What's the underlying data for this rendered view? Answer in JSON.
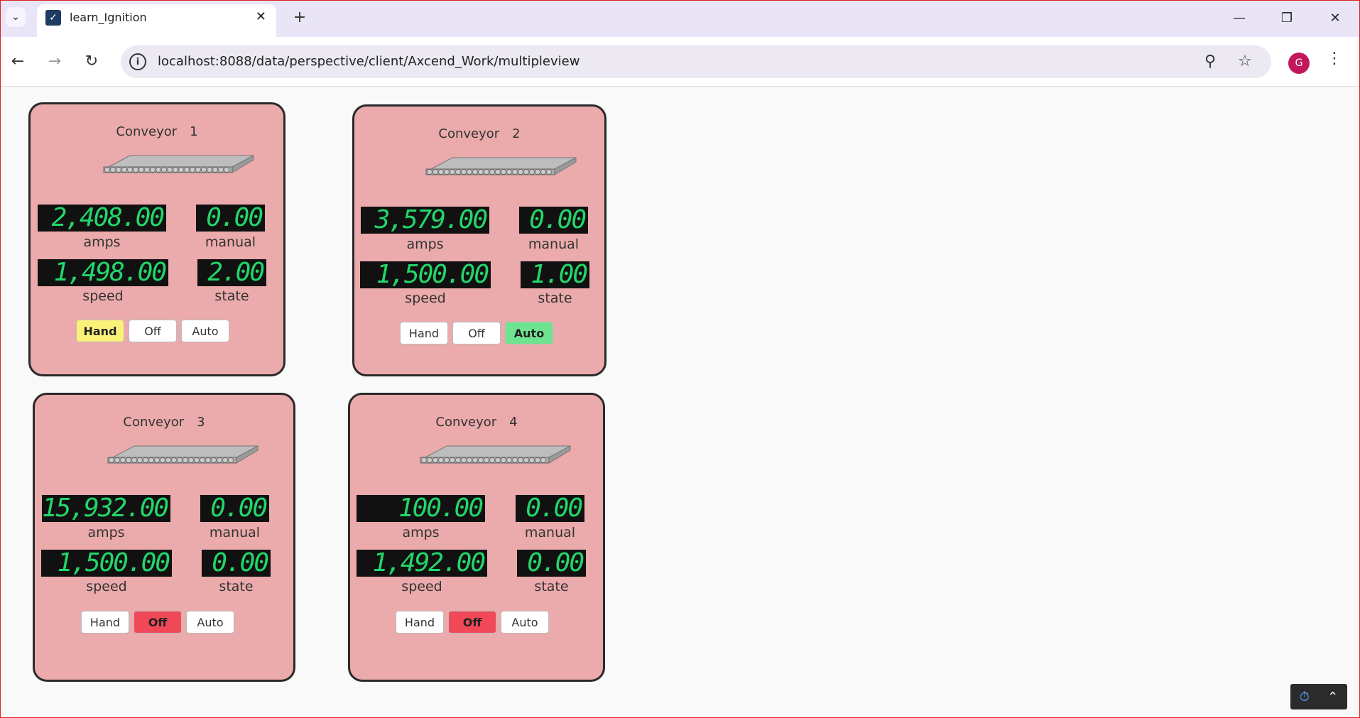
{
  "browser": {
    "tab_title": "learn_Ignition",
    "url": "localhost:8088/data/perspective/client/Axcend_Work/multipleview",
    "profile_initial": "G"
  },
  "cards": [
    {
      "title": "Conveyor",
      "number": "1",
      "amps": "2,408.00",
      "manual": "0.00",
      "speed": "1,498.00",
      "state": "2.00",
      "labels": {
        "amps": "amps",
        "manual": "manual",
        "speed": "speed",
        "state": "state"
      },
      "buttons": {
        "hand": "Hand",
        "off": "Off",
        "auto": "Auto"
      },
      "active": "hand"
    },
    {
      "title": "Conveyor",
      "number": "2",
      "amps": "3,579.00",
      "manual": "0.00",
      "speed": "1,500.00",
      "state": "1.00",
      "labels": {
        "amps": "amps",
        "manual": "manual",
        "speed": "speed",
        "state": "state"
      },
      "buttons": {
        "hand": "Hand",
        "off": "Off",
        "auto": "Auto"
      },
      "active": "auto"
    },
    {
      "title": "Conveyor",
      "number": "3",
      "amps": "15,932.00",
      "manual": "0.00",
      "speed": "1,500.00",
      "state": "0.00",
      "labels": {
        "amps": "amps",
        "manual": "manual",
        "speed": "speed",
        "state": "state"
      },
      "buttons": {
        "hand": "Hand",
        "off": "Off",
        "auto": "Auto"
      },
      "active": "off"
    },
    {
      "title": "Conveyor",
      "number": "4",
      "amps": "100.00",
      "manual": "0.00",
      "speed": "1,492.00",
      "state": "0.00",
      "labels": {
        "amps": "amps",
        "manual": "manual",
        "speed": "speed",
        "state": "state"
      },
      "buttons": {
        "hand": "Hand",
        "off": "Off",
        "auto": "Auto"
      },
      "active": "off"
    }
  ],
  "colors": {
    "card_bg": "#ebaaab",
    "hand_active": "#fbf179",
    "off_active": "#f04856",
    "auto_active": "#6ee491",
    "lcd_text": "#23d66a"
  }
}
